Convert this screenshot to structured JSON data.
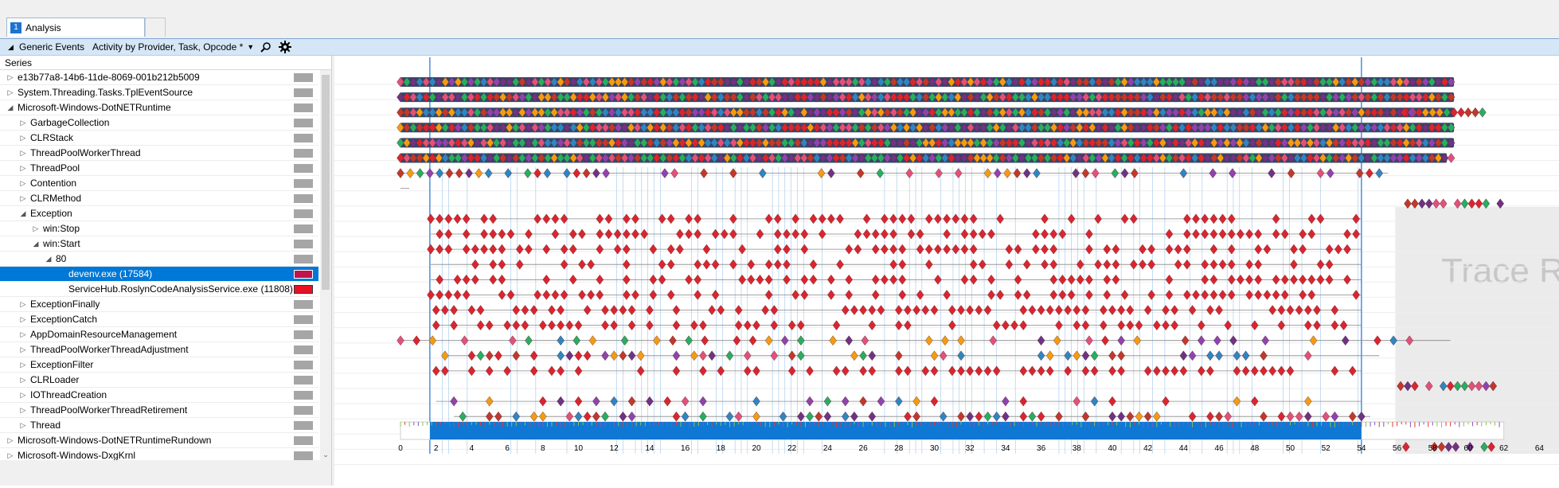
{
  "tabs": [
    {
      "number": "1",
      "label": "Analysis"
    }
  ],
  "toolbar": {
    "collapse_glyph": "◢",
    "table_label": "Generic Events",
    "preset_label": "Activity by Provider, Task, Opcode *",
    "dropdown_glyph": "▼",
    "search_icon": "search-icon",
    "settings_icon": "gear-icon"
  },
  "series_header": "Series",
  "series": [
    {
      "label": "e13b77a8-14b6-11de-8069-001b212b5009",
      "indent": 0,
      "expander": "▷"
    },
    {
      "label": "System.Threading.Tasks.TplEventSource",
      "indent": 0,
      "expander": "▷"
    },
    {
      "label": "Microsoft-Windows-DotNETRuntime",
      "indent": 0,
      "expander": "◢"
    },
    {
      "label": "GarbageCollection",
      "indent": 1,
      "expander": "▷"
    },
    {
      "label": "CLRStack",
      "indent": 1,
      "expander": "▷"
    },
    {
      "label": "ThreadPoolWorkerThread",
      "indent": 1,
      "expander": "▷"
    },
    {
      "label": "ThreadPool",
      "indent": 1,
      "expander": "▷"
    },
    {
      "label": "Contention",
      "indent": 1,
      "expander": "▷"
    },
    {
      "label": "CLRMethod",
      "indent": 1,
      "expander": "▷"
    },
    {
      "label": "Exception",
      "indent": 1,
      "expander": "◢"
    },
    {
      "label": "win:Stop",
      "indent": 2,
      "expander": "▷"
    },
    {
      "label": "win:Start",
      "indent": 2,
      "expander": "◢"
    },
    {
      "label": "80",
      "indent": 3,
      "expander": "◢"
    },
    {
      "label": "devenv.exe (17584)",
      "indent": 4,
      "expander": "",
      "selected": true
    },
    {
      "label": "ServiceHub.RoslynCodeAnalysisService.exe (11808)",
      "indent": 4,
      "expander": "",
      "red": true
    },
    {
      "label": "ExceptionFinally",
      "indent": 1,
      "expander": "▷"
    },
    {
      "label": "ExceptionCatch",
      "indent": 1,
      "expander": "▷"
    },
    {
      "label": "AppDomainResourceManagement",
      "indent": 1,
      "expander": "▷"
    },
    {
      "label": "ThreadPoolWorkerThreadAdjustment",
      "indent": 1,
      "expander": "▷"
    },
    {
      "label": "ExceptionFilter",
      "indent": 1,
      "expander": "▷"
    },
    {
      "label": "CLRLoader",
      "indent": 1,
      "expander": "▷"
    },
    {
      "label": "IOThreadCreation",
      "indent": 1,
      "expander": "▷"
    },
    {
      "label": "ThreadPoolWorkerThreadRetirement",
      "indent": 1,
      "expander": "▷"
    },
    {
      "label": "Thread",
      "indent": 1,
      "expander": "▷"
    },
    {
      "label": "Microsoft-Windows-DotNETRuntimeRundown",
      "indent": 0,
      "expander": "▷"
    },
    {
      "label": "Microsoft-Windows-DxgKrnl",
      "indent": 0,
      "expander": "▷"
    }
  ],
  "scroll_down_glyph": "⌄",
  "graph": {
    "watermark": "Trace R",
    "axis_ticks": [
      "0",
      "2",
      "4",
      "6",
      "8",
      "10",
      "12",
      "14",
      "16",
      "18",
      "20",
      "22",
      "24",
      "26",
      "28",
      "30",
      "32",
      "34",
      "36",
      "38",
      "40",
      "42",
      "44",
      "46",
      "48",
      "50",
      "52",
      "54",
      "56",
      "58",
      "60",
      "62",
      "64"
    ],
    "selection_start": 1.65,
    "selection_end": 54.0,
    "trace_end": 55.4
  },
  "colors": {
    "accent": "#0078d7",
    "selection_row": "#0078d7",
    "diamond_red": "#d9262e",
    "diamond_palette": [
      "#d9262e",
      "#e0527a",
      "#8e44ad",
      "#2e86c1",
      "#f39c12",
      "#27ae60",
      "#c0392b",
      "#6c3483"
    ]
  }
}
